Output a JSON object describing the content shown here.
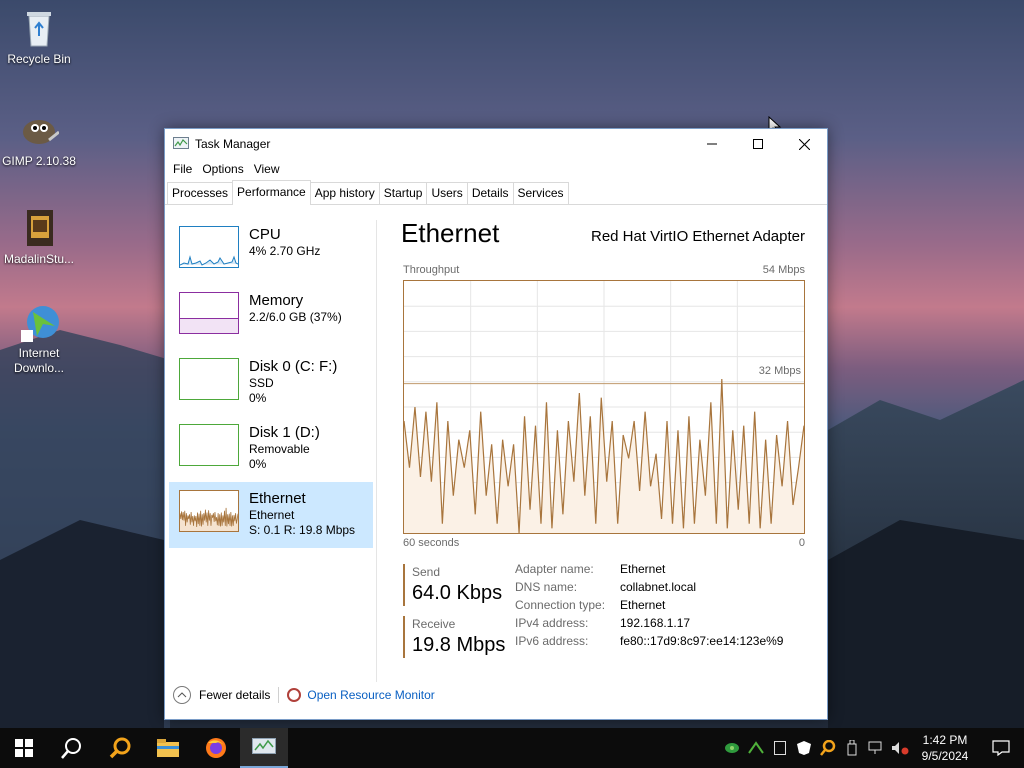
{
  "desktop": {
    "icons": [
      {
        "label": "Recycle Bin",
        "icon": "recycle-bin-icon"
      },
      {
        "label": "GIMP 2.10.38",
        "icon": "gimp-icon"
      },
      {
        "label": "MadalinStu...",
        "icon": "archive-icon"
      },
      {
        "label": "Internet Downlo...",
        "icon": "download-manager-icon"
      }
    ]
  },
  "window": {
    "title": "Task Manager",
    "menu": [
      "File",
      "Options",
      "View"
    ],
    "tabs": [
      "Processes",
      "Performance",
      "App history",
      "Startup",
      "Users",
      "Details",
      "Services"
    ],
    "active_tab": "Performance"
  },
  "sidebar": {
    "items": [
      {
        "name": "CPU",
        "line1": "4%  2.70 GHz",
        "line2": "",
        "color": "#1f7fc1"
      },
      {
        "name": "Memory",
        "line1": "2.2/6.0 GB (37%)",
        "line2": "",
        "color": "#8b2ea0"
      },
      {
        "name": "Disk 0 (C: F:)",
        "line1": "SSD",
        "line2": "0%",
        "color": "#4da83a"
      },
      {
        "name": "Disk 1 (D:)",
        "line1": "Removable",
        "line2": "0%",
        "color": "#4da83a"
      },
      {
        "name": "Ethernet",
        "line1": "Ethernet",
        "line2": "S: 0.1  R: 19.8 Mbps",
        "color": "#a8753d"
      }
    ],
    "selected": "Ethernet"
  },
  "main": {
    "title": "Ethernet",
    "adapter": "Red Hat VirtIO Ethernet Adapter",
    "throughput_label": "Throughput",
    "max_label": "54 Mbps",
    "mid_label": "32 Mbps",
    "x_left": "60 seconds",
    "x_right": "0",
    "graph_values": [
      24,
      14,
      27,
      12,
      26,
      11,
      28,
      2,
      24,
      8,
      20,
      14,
      22,
      4,
      26,
      8,
      19,
      2,
      20,
      10,
      19,
      0,
      25,
      5,
      23,
      2,
      28,
      1,
      22,
      4,
      24,
      11,
      30,
      8,
      25,
      2,
      29,
      11,
      24,
      2,
      21,
      16,
      24,
      9,
      26,
      10,
      17,
      3,
      24,
      2,
      22,
      1,
      25,
      2,
      20,
      8,
      28,
      2,
      33,
      1,
      22,
      5,
      23,
      2,
      26,
      1,
      20,
      2,
      21,
      10,
      24,
      6,
      14,
      23
    ],
    "graph_max": 54,
    "send_label": "Send",
    "send_value": "64.0 Kbps",
    "receive_label": "Receive",
    "receive_value": "19.8 Mbps",
    "details": [
      {
        "key": "Adapter name:",
        "value": "Ethernet"
      },
      {
        "key": "DNS name:",
        "value": "collabnet.local"
      },
      {
        "key": "Connection type:",
        "value": "Ethernet"
      },
      {
        "key": "IPv4 address:",
        "value": "192.168.1.17"
      },
      {
        "key": "IPv6 address:",
        "value": "fe80::17d9:8c97:ee14:123e%9"
      }
    ]
  },
  "footer": {
    "fewer_details": "Fewer details",
    "resource_monitor": "Open Resource Monitor"
  },
  "taskbar": {
    "time": "1:42 PM",
    "date": "9/5/2024"
  }
}
